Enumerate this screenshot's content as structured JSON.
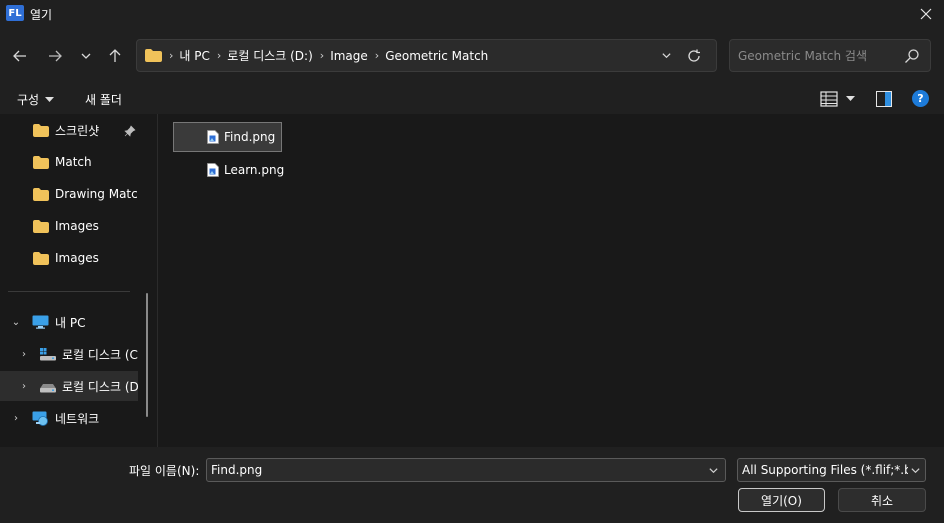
{
  "window": {
    "title": "열기",
    "app_logo": "FL"
  },
  "nav": {
    "breadcrumbs": [
      "내 PC",
      "로컬 디스크 (D:)",
      "Image",
      "Geometric Match"
    ],
    "search_placeholder": "Geometric Match 검색"
  },
  "toolbar": {
    "organize_label": "구성",
    "new_folder_label": "새 폴더",
    "help_label": "?"
  },
  "sidebar": {
    "quick_access": [
      {
        "label": "스크린샷",
        "pinned": true
      },
      {
        "label": "Match"
      },
      {
        "label": "Drawing Match"
      },
      {
        "label": "Images"
      },
      {
        "label": "Images"
      }
    ],
    "this_pc": {
      "label": "내 PC"
    },
    "drives": [
      {
        "label": "로컬 디스크 (C:)"
      },
      {
        "label": "로컬 디스크 (D:)"
      }
    ],
    "network": {
      "label": "네트워크"
    }
  },
  "files": [
    {
      "name": "Find.png",
      "selected": true
    },
    {
      "name": "Learn.png",
      "selected": false
    }
  ],
  "footer": {
    "filename_label": "파일 이름(N):",
    "filename_value": "Find.png",
    "filetype_value": "All Supporting Files (*.flif;*.bmp)",
    "open_label": "열기(O)",
    "cancel_label": "취소"
  },
  "colors": {
    "accent": "#1d7bd9",
    "folder": "#f0c25a",
    "background": "#191919",
    "chrome": "#202020"
  }
}
